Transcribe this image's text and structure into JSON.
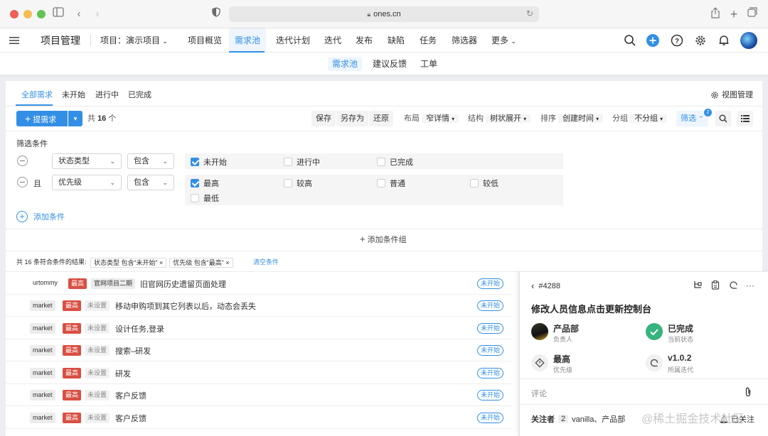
{
  "browser": {
    "url": "ones.cn"
  },
  "header": {
    "project_title": "项目管理",
    "project_select": "项目：演示项目",
    "nav": [
      "项目概览",
      "需求池",
      "迭代计划",
      "迭代",
      "发布",
      "缺陷",
      "任务",
      "筛选器",
      "更多"
    ]
  },
  "subnav": [
    "需求池",
    "建议反馈",
    "工单"
  ],
  "tabs": [
    "全部需求",
    "未开始",
    "进行中",
    "已完成"
  ],
  "view_manage": "视图管理",
  "toolbar": {
    "create": "提需求",
    "total_prefix": "共",
    "total": "16",
    "total_suffix": "个",
    "save": "保存",
    "save_as": "另存为",
    "restore": "还原",
    "layout_label": "布局",
    "layout_value": "窄详情",
    "structure_label": "结构",
    "structure_value": "树状展开",
    "sort_label": "排序",
    "sort_value": "创建时间",
    "group_label": "分组",
    "group_value": "不分组",
    "filter": "筛选",
    "filter_count": "2"
  },
  "filter": {
    "title": "筛选条件",
    "conj": "且",
    "rows": [
      {
        "field": "状态类型",
        "op": "包含",
        "options": [
          "未开始",
          "进行中",
          "已完成"
        ]
      },
      {
        "field": "优先级",
        "op": "包含",
        "options": [
          "最高",
          "较高",
          "普通",
          "较低",
          "最低"
        ]
      }
    ],
    "add_condition": "添加条件",
    "add_group": "添加条件组"
  },
  "result": {
    "text": "共 16 条符合条件的结果:",
    "chips": [
      "状态类型 包含“未开始”",
      "优先级 包含“最高”"
    ],
    "clear": "清空条件"
  },
  "rows": [
    {
      "user": "urtommy",
      "priority": "最高",
      "tag": "官网项目二期",
      "title": "旧官网历史遗留页面处理",
      "status": "未开始"
    },
    {
      "user": "market",
      "priority": "最高",
      "tag": "未设置",
      "title": "移动申购项到其它列表以后，动态会丢失",
      "status": "未开始"
    },
    {
      "user": "market",
      "priority": "最高",
      "tag": "未设置",
      "title": "设计任务,登录",
      "status": "未开始"
    },
    {
      "user": "market",
      "priority": "最高",
      "tag": "未设置",
      "title": "搜索–研发",
      "status": "未开始"
    },
    {
      "user": "market",
      "priority": "最高",
      "tag": "未设置",
      "title": "研发",
      "status": "未开始"
    },
    {
      "user": "market",
      "priority": "最高",
      "tag": "未设置",
      "title": "客户反馈",
      "status": "未开始"
    },
    {
      "user": "market",
      "priority": "最高",
      "tag": "未设置",
      "title": "客户反馈",
      "status": "未开始"
    }
  ],
  "detail": {
    "id": "#4288",
    "title": "修改人员信息点击更新控制台",
    "fields": [
      {
        "value": "产品部",
        "label": "负责人"
      },
      {
        "value": "已完成",
        "label": "当前状态"
      },
      {
        "value": "最高",
        "label": "优先级"
      },
      {
        "value": "v1.0.2",
        "label": "所属迭代"
      }
    ],
    "comment": "评论",
    "watchers_label": "关注者",
    "watchers_count": "2",
    "watchers": "vanilla、产品部",
    "watch_action": "已关注"
  },
  "watermark": "@稀土掘金技术社区",
  "colors": {
    "accent": "#338fe5",
    "danger": "#d94f43",
    "success": "#36b37e"
  }
}
